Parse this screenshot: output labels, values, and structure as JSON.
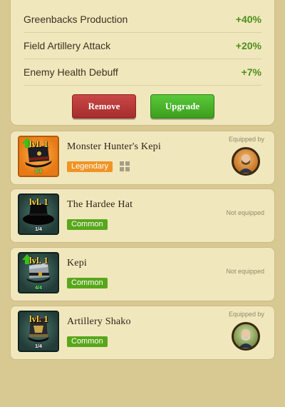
{
  "stats": [
    {
      "label": "Greenbacks Production",
      "value": "+40%"
    },
    {
      "label": "Field Artillery Attack",
      "value": "+20%"
    },
    {
      "label": "Enemy Health Debuff",
      "value": "+7%"
    }
  ],
  "actions": {
    "remove_label": "Remove",
    "upgrade_label": "Upgrade"
  },
  "items": [
    {
      "level": "lvl. 1",
      "name": "Monster Hunter's Kepi",
      "rarity": "Legendary",
      "count": "8/4",
      "status": "Equipped by",
      "upgradable": true,
      "frame": "orange",
      "icon": "kepi-black-icon"
    },
    {
      "level": "lvl. 1",
      "name": "The Hardee Hat",
      "rarity": "Common",
      "count": "1/4",
      "status": "Not equipped",
      "upgradable": false,
      "frame": "teal",
      "icon": "hardee-hat-icon"
    },
    {
      "level": "lvl. 1",
      "name": "Kepi",
      "rarity": "Common",
      "count": "4/4",
      "status": "Not equipped",
      "upgradable": true,
      "frame": "teal",
      "icon": "kepi-grey-icon"
    },
    {
      "level": "lvl. 1",
      "name": "Artillery Shako",
      "rarity": "Common",
      "count": "1/4",
      "status": "Equipped by",
      "upgradable": false,
      "frame": "teal",
      "icon": "shako-icon"
    }
  ],
  "colors": {
    "accent_green": "#58a71b",
    "legendary": "#f09425",
    "remove": "#b83838",
    "upgrade": "#47b227",
    "panel": "#f1e7bd",
    "background": "#d8c892"
  }
}
